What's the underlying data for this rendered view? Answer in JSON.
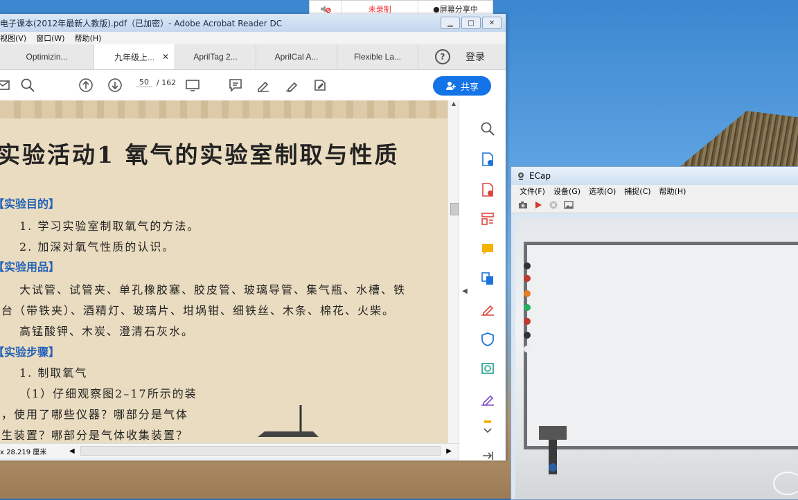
{
  "recording_bar": {
    "mute_icon": "speaker-muted-icon",
    "status": "未录制",
    "share_status": "●屏幕分享中"
  },
  "acrobat": {
    "title": "电子课本(2012年最新人教版).pdf（已加密）- Adobe Acrobat Reader DC",
    "menu": [
      "视图(V)",
      "窗口(W)",
      "帮助(H)"
    ],
    "tabs": [
      {
        "label": "Optimizin...",
        "active": false
      },
      {
        "label": "九年级上...",
        "active": true
      },
      {
        "label": "AprilTag 2...",
        "active": false
      },
      {
        "label": "AprilCal A...",
        "active": false
      },
      {
        "label": "Flexible La...",
        "active": false
      }
    ],
    "help_label": "?",
    "login_label": "登录",
    "page_current": "50",
    "page_total": "/ 162",
    "share_label": "共享",
    "page_size": "x 28.219 厘米"
  },
  "document": {
    "heading": "实验活动1  氧气的实验室制取与性质",
    "sections": [
      {
        "title": "【实验目的】"
      },
      {
        "title": "【实验用品】"
      },
      {
        "title": "【实验步骤】"
      }
    ],
    "lines": {
      "goal1": "1. 学习实验室制取氧气的方法。",
      "goal2": "2. 加深对氧气性质的认识。",
      "supplies1": "大试管、试管夹、单孔橡胶塞、胶皮管、玻璃导管、集气瓶、水槽、铁",
      "supplies2": "架台（带铁夹）、酒精灯、玻璃片、坩埚钳、细铁丝、木条、棉花、火柴。",
      "supplies3": "高锰酸钾、木炭、澄清石灰水。",
      "step1": "1. 制取氧气",
      "step2": "（1）仔细观察图2–17所示的装",
      "step3": "置，使用了哪些仪器？哪部分是气体",
      "step4": "发生装置？哪部分是气体收集装置？"
    }
  },
  "ecap": {
    "title": "ECap",
    "menu": [
      "文件(F)",
      "设备(G)",
      "选项(O)",
      "捕捉(C)",
      "帮助(H)"
    ],
    "toolbar_icons": [
      "camera-icon",
      "play-icon",
      "stop-icon",
      "image-icon"
    ]
  },
  "colors": {
    "accent": "#1473e6",
    "section_blue": "#2262b8",
    "page_bg": "#eadcc0"
  }
}
